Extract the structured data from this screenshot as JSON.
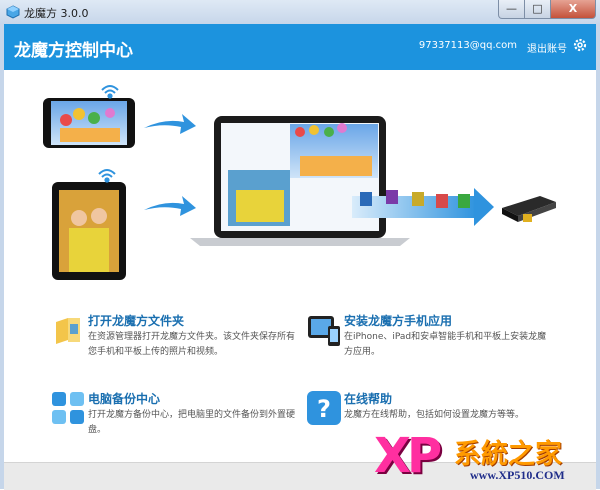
{
  "window": {
    "title": "龙魔方 3.0.0",
    "min_label": "—",
    "max_label": "□",
    "close_label": "X"
  },
  "header": {
    "title": "龙魔方控制中心",
    "email": "97337113@qq.com",
    "logout": "退出账号",
    "settings_icon": "gear-icon"
  },
  "colors": {
    "header_bg": "#1c93de",
    "title_accent": "#1a6fb0",
    "watermark_pink": "#ff2fa0",
    "watermark_orange": "#ff9a00"
  },
  "features": [
    {
      "title": "打开龙魔方文件夹",
      "desc": "在资源管理器打开龙魔方文件夹。该文件夹保存所有您手机和平板上传的照片和视频。",
      "icon": "folder-icon"
    },
    {
      "title": "安装龙魔方手机应用",
      "desc": "在iPhone、iPad和安卓智能手机和平板上安装龙魔方应用。",
      "icon": "phone-app-icon"
    },
    {
      "title": "电脑备份中心",
      "desc": "打开龙魔方备份中心，把电脑里的文件备份到外置硬盘。",
      "icon": "backup-icon"
    },
    {
      "title": "在线帮助",
      "desc": "龙魔方在线帮助，包括如何设置龙魔方等等。",
      "icon": "help-icon"
    }
  ],
  "watermark": {
    "logo": "XP",
    "name": "系統之家",
    "url": "www.XP510.COM"
  }
}
